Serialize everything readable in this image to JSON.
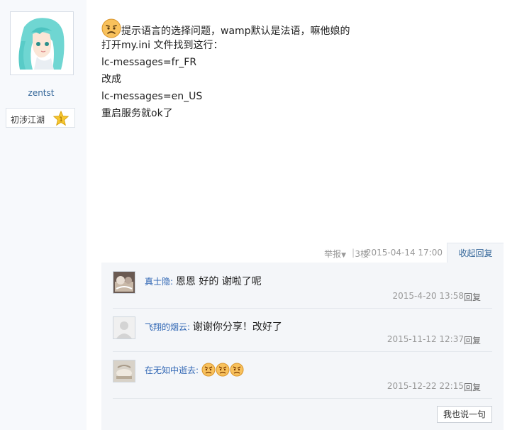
{
  "user": {
    "name": "zentst",
    "rank": "初涉江湖",
    "rank_level": "1"
  },
  "post": {
    "lines": [
      "提示语言的选择问题，wamp默认是法语，嘛他娘的",
      "打开my.ini 文件找到这行：",
      "lc-messages=fr_FR",
      "改成",
      "lc-messages=en_US",
      "重启服务就ok了"
    ],
    "emoji_icon": "sad-face-icon"
  },
  "meta": {
    "report": "举报",
    "separator": "|",
    "floor": "3楼",
    "time": "2015-04-14 17:00",
    "collapse": "收起回复"
  },
  "comments": [
    {
      "author": "真士隐:",
      "text": "恩恩 好的 谢啦了呢",
      "time": "2015-4-20 13:58",
      "reply": "回复"
    },
    {
      "author": "飞翔的烟云:",
      "text": "谢谢你分享！改好了",
      "time": "2015-11-12 12:37",
      "reply": "回复"
    },
    {
      "author": "在无知中逝去:",
      "text": "",
      "time": "2015-12-22 22:15",
      "reply": "回复",
      "emoji_count": "3",
      "emoji_icon": "angry-face-icon"
    }
  ],
  "speak_button": "我也说一句",
  "colors": {
    "link": "#336699",
    "author": "#2d64b3",
    "sidebar_bg": "#f7f9fc",
    "comment_bg": "#f4f6f9",
    "meta": "#999999"
  }
}
